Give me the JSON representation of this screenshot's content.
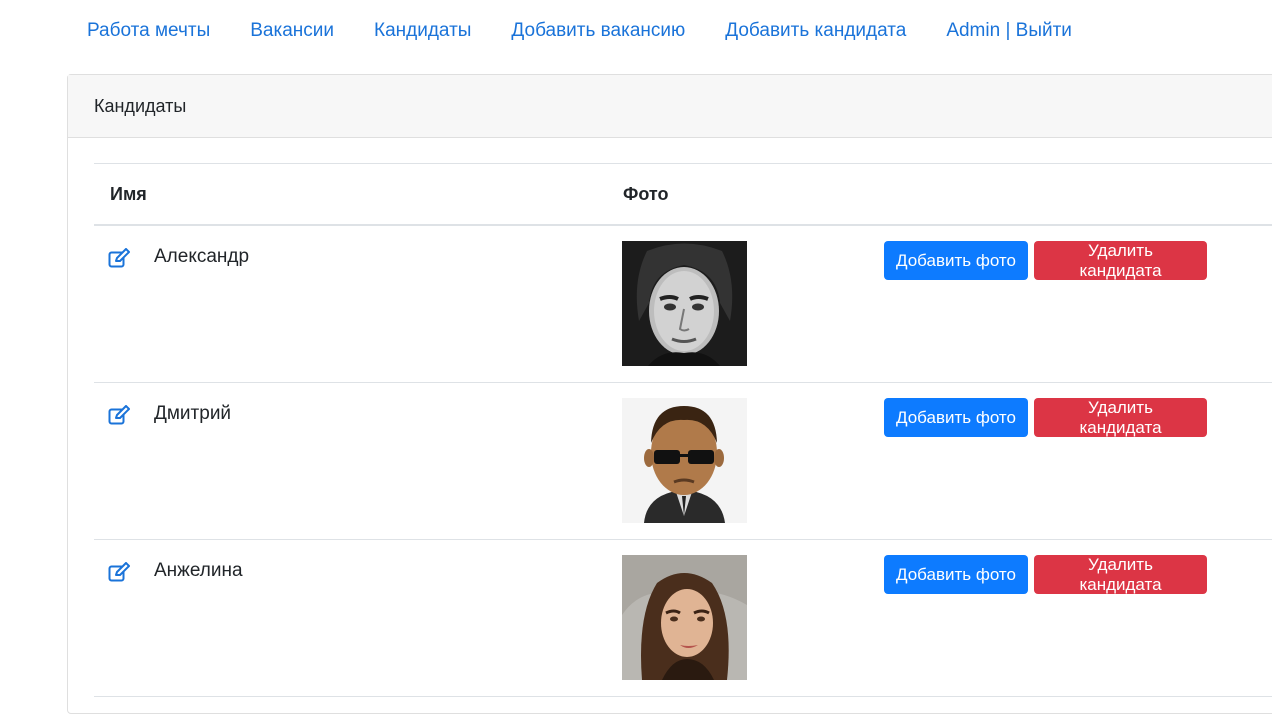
{
  "nav": {
    "items": [
      {
        "label": "Работа мечты"
      },
      {
        "label": "Вакансии"
      },
      {
        "label": "Кандидаты"
      },
      {
        "label": "Добавить вакансию"
      },
      {
        "label": "Добавить кандидата"
      },
      {
        "label": "Admin | Выйти"
      }
    ]
  },
  "card": {
    "title": "Кандидаты"
  },
  "table": {
    "columns": [
      "Имя",
      "Фото"
    ],
    "rows": [
      {
        "name": "Александр",
        "photo_icon": "portrait-photo-bw-man",
        "add_photo": "Добавить фото",
        "delete": "Удалить кандидата"
      },
      {
        "name": "Дмитрий",
        "photo_icon": "portrait-cartoon-agent",
        "add_photo": "Добавить фото",
        "delete": "Удалить кандидата"
      },
      {
        "name": "Анжелина",
        "photo_icon": "portrait-painting-woman",
        "add_photo": "Добавить фото",
        "delete": "Удалить кандидата"
      }
    ]
  },
  "colors": {
    "link": "#1a73d9",
    "primary": "#0d7bff",
    "danger": "#dc3545"
  }
}
